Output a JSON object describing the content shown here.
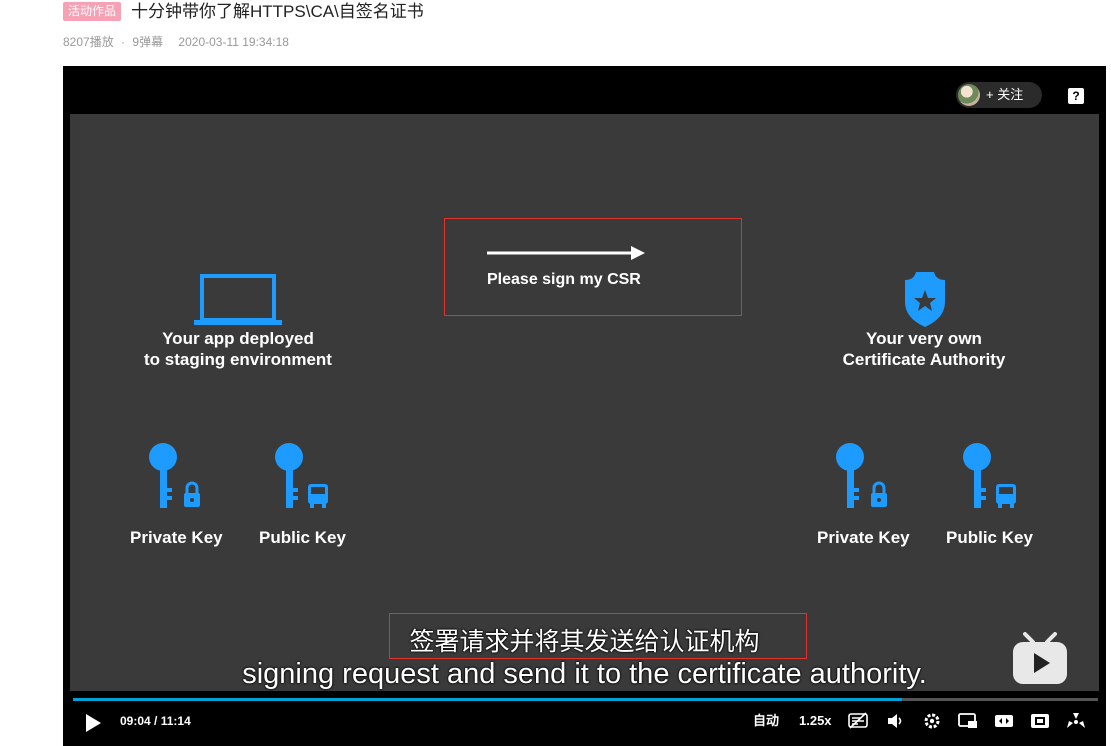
{
  "header": {
    "badge": "活动作品",
    "title": "十分钟带你了解HTTPS\\CA\\自签名证书",
    "plays": "8207播放",
    "separator": "·",
    "danmaku": "9弹幕",
    "date": "2020-03-11 19:34:18"
  },
  "player": {
    "follow_label": "+ 关注",
    "help_label": "?",
    "slide": {
      "csr_text": "Please sign my CSR",
      "app_label_line1": "Your app deployed",
      "app_label_line2": "to staging environment",
      "ca_label_line1": "Your very own",
      "ca_label_line2": "Certificate Authority",
      "left_private_key": "Private Key",
      "left_public_key": "Public Key",
      "right_private_key": "Private Key",
      "right_public_key": "Public Key",
      "icon_color": "#1e9bff"
    },
    "subtitle_cn": "签署请求并将其发送给认证机构",
    "subtitle_en": "signing request and send it to the certificate authority.",
    "progress_fraction": 0.809,
    "current_time": "09:04",
    "time_separator": "/",
    "total_time": "11:14",
    "quality_label": "自动",
    "speed_label": "1.25x",
    "icons": [
      "play-icon",
      "danmaku-toggle-icon",
      "volume-icon",
      "settings-icon",
      "pip-icon",
      "widescreen-icon",
      "web-fullscreen-icon",
      "fullscreen-icon",
      "bilibili-tv-icon"
    ],
    "accent": "#00a1d6",
    "highlight": "#e0312b"
  }
}
